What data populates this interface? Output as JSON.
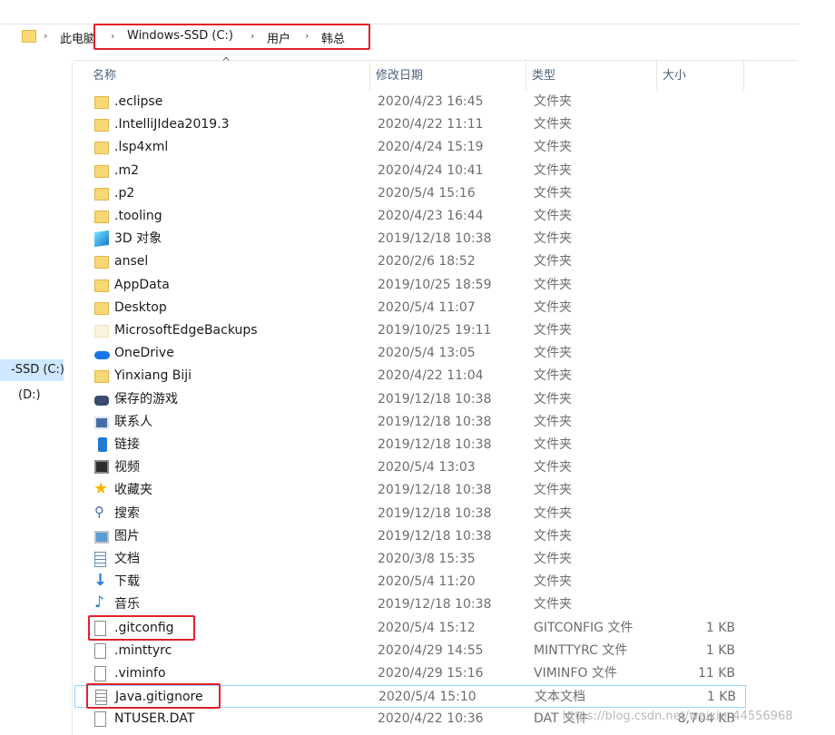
{
  "breadcrumb": {
    "items": [
      "此电脑",
      "Windows-SSD (C:)",
      "用户",
      "韩总"
    ]
  },
  "nav": {
    "drives": [
      "-SSD (C:)",
      "(D:)"
    ]
  },
  "columns": {
    "name": "名称",
    "date": "修改日期",
    "type": "类型",
    "size": "大小"
  },
  "files": [
    {
      "name": ".eclipse",
      "date": "2020/4/23 16:45",
      "type": "文件夹",
      "size": "",
      "icon": "folder-icon"
    },
    {
      "name": ".IntelliJIdea2019.3",
      "date": "2020/4/22 11:11",
      "type": "文件夹",
      "size": "",
      "icon": "folder-icon"
    },
    {
      "name": ".lsp4xml",
      "date": "2020/4/24 15:19",
      "type": "文件夹",
      "size": "",
      "icon": "folder-icon"
    },
    {
      "name": ".m2",
      "date": "2020/4/24 10:41",
      "type": "文件夹",
      "size": "",
      "icon": "folder-icon"
    },
    {
      "name": ".p2",
      "date": "2020/5/4 15:16",
      "type": "文件夹",
      "size": "",
      "icon": "folder-icon"
    },
    {
      "name": ".tooling",
      "date": "2020/4/23 16:44",
      "type": "文件夹",
      "size": "",
      "icon": "folder-icon"
    },
    {
      "name": "3D 对象",
      "date": "2019/12/18 10:38",
      "type": "文件夹",
      "size": "",
      "icon": "3d-objects-icon"
    },
    {
      "name": "ansel",
      "date": "2020/2/6 18:52",
      "type": "文件夹",
      "size": "",
      "icon": "folder-icon"
    },
    {
      "name": "AppData",
      "date": "2019/10/25 18:59",
      "type": "文件夹",
      "size": "",
      "icon": "folder-icon"
    },
    {
      "name": "Desktop",
      "date": "2020/5/4 11:07",
      "type": "文件夹",
      "size": "",
      "icon": "folder-icon"
    },
    {
      "name": "MicrosoftEdgeBackups",
      "date": "2019/10/25 19:11",
      "type": "文件夹",
      "size": "",
      "icon": "faint-folder-icon"
    },
    {
      "name": "OneDrive",
      "date": "2020/5/4 13:05",
      "type": "文件夹",
      "size": "",
      "icon": "onedrive-cloud-icon"
    },
    {
      "name": "Yinxiang Biji",
      "date": "2020/4/22 11:04",
      "type": "文件夹",
      "size": "",
      "icon": "folder-icon"
    },
    {
      "name": "保存的游戏",
      "date": "2019/12/18 10:38",
      "type": "文件夹",
      "size": "",
      "icon": "saved-games-icon"
    },
    {
      "name": "联系人",
      "date": "2019/12/18 10:38",
      "type": "文件夹",
      "size": "",
      "icon": "contacts-icon"
    },
    {
      "name": "链接",
      "date": "2019/12/18 10:38",
      "type": "文件夹",
      "size": "",
      "icon": "links-icon"
    },
    {
      "name": "视频",
      "date": "2020/5/4 13:03",
      "type": "文件夹",
      "size": "",
      "icon": "videos-icon"
    },
    {
      "name": "收藏夹",
      "date": "2019/12/18 10:38",
      "type": "文件夹",
      "size": "",
      "icon": "favorites-star-icon"
    },
    {
      "name": "搜索",
      "date": "2019/12/18 10:38",
      "type": "文件夹",
      "size": "",
      "icon": "search-icon"
    },
    {
      "name": "图片",
      "date": "2019/12/18 10:38",
      "type": "文件夹",
      "size": "",
      "icon": "pictures-icon"
    },
    {
      "name": "文档",
      "date": "2020/3/8 15:35",
      "type": "文件夹",
      "size": "",
      "icon": "documents-icon"
    },
    {
      "name": "下载",
      "date": "2020/5/4 11:20",
      "type": "文件夹",
      "size": "",
      "icon": "downloads-arrow-icon"
    },
    {
      "name": "音乐",
      "date": "2019/12/18 10:38",
      "type": "文件夹",
      "size": "",
      "icon": "music-note-icon"
    },
    {
      "name": ".gitconfig",
      "date": "2020/5/4 15:12",
      "type": "GITCONFIG 文件",
      "size": "1 KB",
      "icon": "file-icon"
    },
    {
      "name": ".minttyrc",
      "date": "2020/4/29 14:55",
      "type": "MINTTYRC 文件",
      "size": "1 KB",
      "icon": "file-icon"
    },
    {
      "name": ".viminfo",
      "date": "2020/4/29 15:16",
      "type": "VIMINFO 文件",
      "size": "11 KB",
      "icon": "file-icon"
    },
    {
      "name": "Java.gitignore",
      "date": "2020/5/4 15:10",
      "type": "文本文档",
      "size": "1 KB",
      "icon": "text-file-icon"
    },
    {
      "name": "NTUSER.DAT",
      "date": "2020/4/22 10:36",
      "type": "DAT 文件",
      "size": "8,704 KB",
      "icon": "file-icon"
    }
  ],
  "watermark": "https://blog.csdn.net/weixin_44556968",
  "colors": {
    "highlight": "#e0202a",
    "selection": "#cde8ff",
    "folder": "#f8d775"
  }
}
